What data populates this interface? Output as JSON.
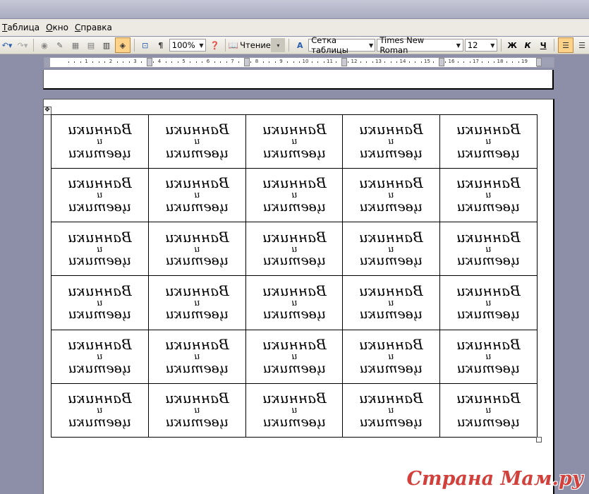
{
  "menu": [
    {
      "accel": "Т",
      "rest": "аблица"
    },
    {
      "accel": "О",
      "rest": "кно"
    },
    {
      "accel": "С",
      "rest": "правка"
    }
  ],
  "toolbar": {
    "zoom": "100%",
    "reading_label": "Чтение",
    "style": "Сетка таблицы",
    "font": "Times New Roman",
    "font_size": "12",
    "bold_label": "Ж",
    "italic_label": "К",
    "underline_label": "Ч"
  },
  "ruler": {
    "ticks": [
      "1",
      "2",
      "3",
      "4",
      "5",
      "6",
      "7",
      "8",
      "9",
      "10",
      "11",
      "12",
      "13",
      "14",
      "15",
      "16",
      "17",
      "18",
      "19"
    ]
  },
  "label": {
    "line1": "Ванники",
    "line2": "и",
    "line3": "цветики"
  },
  "table": {
    "rows": 6,
    "cols": 5
  },
  "watermark": "Страна Мам.ру"
}
